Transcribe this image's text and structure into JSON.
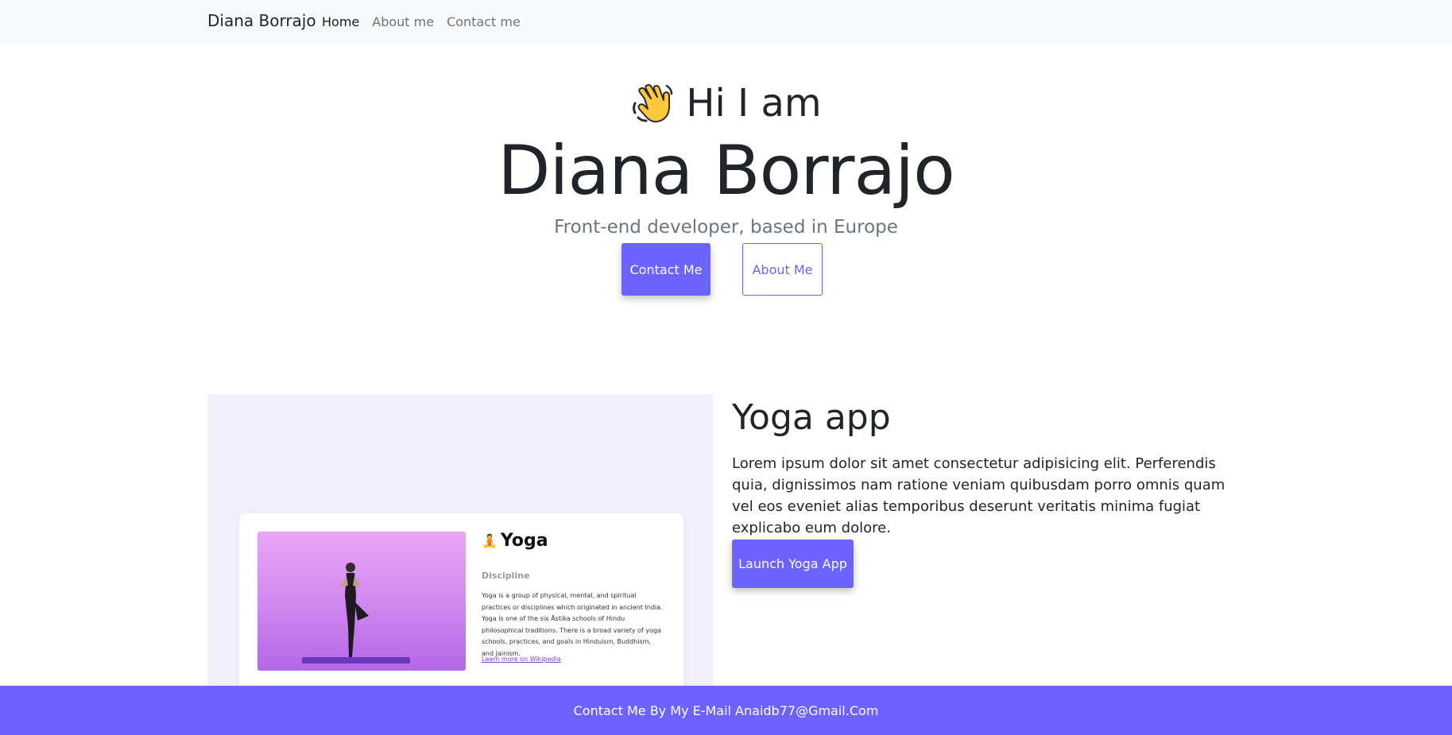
{
  "navbar": {
    "brand": "Diana Borrajo",
    "links": [
      {
        "label": "Home",
        "active": true
      },
      {
        "label": "About me",
        "active": false
      },
      {
        "label": "Contact me",
        "active": false
      }
    ]
  },
  "hero": {
    "greeting_icon": "waving-hand-icon",
    "greeting": "Hi I am",
    "name": "Diana Borrajo",
    "subtitle": "Front-end developer, based in Europe",
    "primary_button": "Contact Me",
    "secondary_button": "About Me"
  },
  "project": {
    "preview": {
      "title_icon": "meditation-icon",
      "title": "Yoga",
      "subtitle": "Discipline",
      "text": "Yoga is a group of physical, mental, and spiritual practices or disciplines which originated in ancient India. Yoga is one of the six Āstika schools of Hindu philosophical traditions. There is a broad variety of yoga schools, practices, and goals in Hinduism, Buddhism, and Jainism.",
      "link": "Learn more on Wikipedia"
    },
    "title": "Yoga app",
    "description": "Lorem ipsum dolor sit amet consectetur adipisicing elit. Perferendis quia, dignissimos nam ratione veniam quibusdam porro omnis quam vel eos eveniet alias temporibus deserunt veritatis minima fugiat explicabo eum dolore.",
    "button": "Launch Yoga App"
  },
  "footer": {
    "text": "Contact Me By My E-Mail Anaidb77@Gmail.Com"
  },
  "colors": {
    "accent": "#6c63ff",
    "navbar_bg": "#f8f9fa",
    "project_bg": "#f3f0fd"
  }
}
